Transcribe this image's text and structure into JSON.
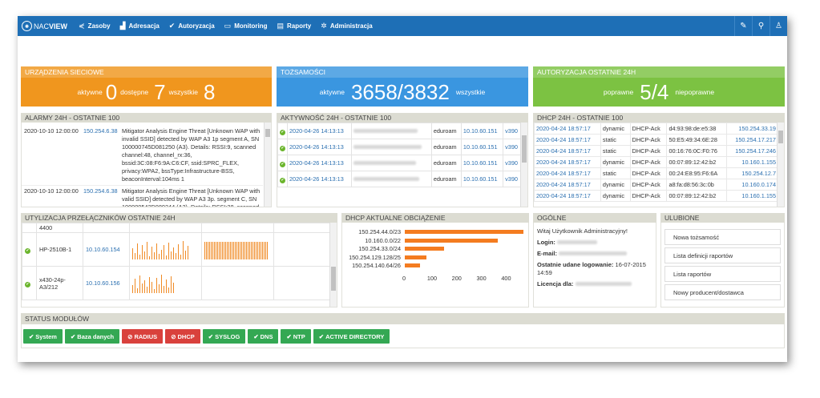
{
  "navbar": {
    "brand_prefix": "NAC",
    "brand_suffix": "VIEW",
    "items": [
      {
        "label": "Zasoby",
        "icon": "share-icon"
      },
      {
        "label": "Adresacja",
        "icon": "chart-icon"
      },
      {
        "label": "Autoryzacja",
        "icon": "check-icon"
      },
      {
        "label": "Monitoring",
        "icon": "monitor-icon"
      },
      {
        "label": "Raporty",
        "icon": "document-icon"
      },
      {
        "label": "Administracja",
        "icon": "gear-icon"
      }
    ],
    "right_icons": [
      "notes-icon",
      "search-icon",
      "user-icon"
    ]
  },
  "stats": {
    "devices": {
      "title": "URZĄDZENIA SIECIOWE",
      "active_label": "aktywne",
      "active": "0",
      "available_label": "dostępne",
      "available": "7",
      "all_label": "wszystkie",
      "all": "8",
      "color": "#f0961e"
    },
    "identities": {
      "title": "TOŻSAMOŚCI",
      "active_label": "aktywne",
      "value": "3658/3832",
      "all_label": "wszystkie",
      "color": "#3a96e0"
    },
    "auth": {
      "title": "AUTORYZACJA OSTATNIE 24H",
      "ok_label": "poprawne",
      "value": "5/4",
      "bad_label": "niepoprawne",
      "color": "#7cc242"
    }
  },
  "alarms": {
    "title": "ALARMY 24H - OSTATNIE 100",
    "rows": [
      {
        "time": "2020-10-10 12:00:00",
        "ip": "150.254.6.38",
        "text": "Mitigator Analysis Engine Threat [Unknown WAP with invalid SSID] detected by WAP A3 1p segment A, SN 100000745D081250 (A3). Details: RSSI:9, scanned channel:48, channel_rx:36, bssid:3C:08:F6:9A:C6:CF, ssid:SPRC_FLEX, privacy:WPA2, bssType:Infrastructure-BSS, beaconInterval:104ms 1"
      },
      {
        "time": "2020-10-10 12:00:00",
        "ip": "150.254.6.38",
        "text": "Mitigator Analysis Engine Threat [Unknown WAP with valid SSID] detected by WAP A3 3p. segment C, SN 100000542D080244 (A3). Details: RSSI:28, scanned"
      }
    ]
  },
  "activity": {
    "title": "AKTYWNOŚĆ 24H - OSTATNIE 100",
    "rows": [
      {
        "time": "2020-04-26 14:13:13",
        "ssid": "eduroam",
        "ip": "10.10.60.151",
        "vlan": "v390"
      },
      {
        "time": "2020-04-26 14:13:13",
        "ssid": "eduroam",
        "ip": "10.10.60.151",
        "vlan": "v390"
      },
      {
        "time": "2020-04-26 14:13:13",
        "ssid": "eduroam",
        "ip": "10.10.60.151",
        "vlan": "v390"
      },
      {
        "time": "2020-04-26 14:13:13",
        "ssid": "eduroam",
        "ip": "10.10.60.151",
        "vlan": "v390"
      }
    ]
  },
  "dhcp24": {
    "title": "DHCP 24H - OSTATNIE 100",
    "rows": [
      {
        "time": "2020-04-24 18:57:17",
        "type": "dynamic",
        "msg": "DHCP-Ack",
        "mac": "d4:93:98:de:e5:38",
        "ip": "150.254.33.19"
      },
      {
        "time": "2020-04-24 18:57:17",
        "type": "static",
        "msg": "DHCP-Ack",
        "mac": "50:E5:49:34:6E:28",
        "ip": "150.254.17.217"
      },
      {
        "time": "2020-04-24 18:57:17",
        "type": "static",
        "msg": "DHCP-Ack",
        "mac": "00:16:76:0C:F0:76",
        "ip": "150.254.17.246"
      },
      {
        "time": "2020-04-24 18:57:17",
        "type": "dynamic",
        "msg": "DHCP-Ack",
        "mac": "00:07:89:12:42:b2",
        "ip": "10.160.1.155"
      },
      {
        "time": "2020-04-24 18:57:17",
        "type": "static",
        "msg": "DHCP-Ack",
        "mac": "00:24:E8:95:F6:6A",
        "ip": "150.254.12.7"
      },
      {
        "time": "2020-04-24 18:57:17",
        "type": "dynamic",
        "msg": "DHCP-Ack",
        "mac": "a8:fa:d8:56:3c:0b",
        "ip": "10.160.0.174"
      },
      {
        "time": "2020-04-24 18:57:17",
        "type": "dynamic",
        "msg": "DHCP-Ack",
        "mac": "00:07:89:12:42:b2",
        "ip": "10.160.1.155"
      }
    ]
  },
  "switches": {
    "title": "UTYLIZACJA PRZEŁĄCZNIKÓW OSTATNIE 24H",
    "partial_top": "4400",
    "rows": [
      {
        "name": "HP-2510B-1",
        "ip": "10.10.60.154"
      },
      {
        "name": "x430-24p-A3/212",
        "ip": "10.10.60.156"
      }
    ]
  },
  "dhcp_load": {
    "title": "DHCP AKTUALNE OBCIĄŻENIE",
    "chart_data": {
      "type": "bar",
      "orientation": "horizontal",
      "categories": [
        "150.254.44.0/23",
        "10.160.0.0/22",
        "150.254.33.0/24",
        "150.254.129.128/25",
        "150.254.140.64/26"
      ],
      "values": [
        480,
        375,
        160,
        88,
        62
      ],
      "xlim": [
        0,
        480
      ],
      "xticks": [
        "0",
        "100",
        "200",
        "300",
        "400"
      ],
      "color": "#f47c20"
    }
  },
  "general": {
    "title": "OGÓLNE",
    "welcome": "Witaj Użytkownik Administracyjny!",
    "login_label": "Login:",
    "email_label": "E-mail:",
    "last_login_label": "Ostatnie udane logowanie:",
    "last_login_value": "16-07-2015 14:59",
    "license_label": "Licencja dla:"
  },
  "favorites": {
    "title": "ULUBIONE",
    "items": [
      "Nowa tożsamość",
      "Lista definicji raportów",
      "Lista raportów",
      "Nowy producent/dostawca"
    ]
  },
  "modules": {
    "title": "STATUS MODUŁÓW",
    "items": [
      {
        "label": "System",
        "ok": true
      },
      {
        "label": "Baza danych",
        "ok": true
      },
      {
        "label": "RADIUS",
        "ok": false
      },
      {
        "label": "DHCP",
        "ok": false
      },
      {
        "label": "SYSLOG",
        "ok": true
      },
      {
        "label": "DNS",
        "ok": true
      },
      {
        "label": "NTP",
        "ok": true
      },
      {
        "label": "ACTIVE DIRECTORY",
        "ok": true
      }
    ]
  }
}
